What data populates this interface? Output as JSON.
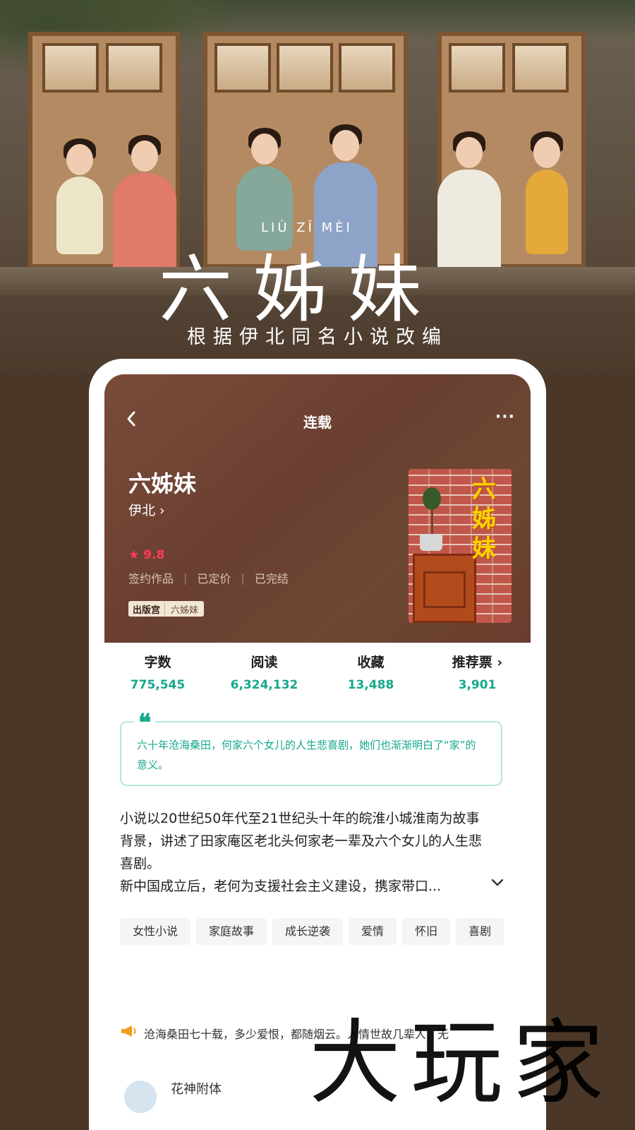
{
  "poster": {
    "pinyin": "LIÙ ZǏ MÈI",
    "title": "六姊妹",
    "subtitle": "根据伊北同名小说改编"
  },
  "nav": {
    "back_icon": "chevron-left-icon",
    "title": "连载",
    "more_label": "···"
  },
  "book": {
    "title": "六姊妹",
    "author": "伊北 ›",
    "rating": "★ 9.8",
    "tags_meta": [
      "签约作品",
      "已定价",
      "已完结"
    ],
    "meta_separator": "|",
    "publisher_logo": "出版宫",
    "publisher_label": "六姊妹",
    "cover_title": "六姊妹"
  },
  "stats": [
    {
      "label": "字数",
      "value": "775,545"
    },
    {
      "label": "阅读",
      "value": "6,324,132"
    },
    {
      "label": "收藏",
      "value": "13,488"
    },
    {
      "label": "推荐票 ›",
      "value": "3,901"
    }
  ],
  "quote": {
    "mark": "❝",
    "text": "六十年沧海桑田，何家六个女儿的人生悲喜剧，她们也渐渐明白了“家”的意义。"
  },
  "description": {
    "p1": "小说以20世纪50年代至21世纪头十年的皖淮小城淮南为故事背景，讲述了田家庵区老北头何家老一辈及六个女儿的人生悲喜剧。",
    "p2": "新中国成立后，老何为支援社会主义建设，携家带口...",
    "expand_icon": "⌄"
  },
  "genre_tags": [
    "女性小说",
    "家庭故事",
    "成长逆袭",
    "爱情",
    "怀旧",
    "喜剧"
  ],
  "notice": {
    "text": "沧海桑田七十载，多少爱恨，都随烟云。人情世故几辈人，无"
  },
  "recommend": {
    "name": "花神附体"
  },
  "watermark": "大玩家",
  "colors": {
    "accent": "#16a88c",
    "rating": "#ff3b5c",
    "hero_bg": "#6a3f30"
  }
}
